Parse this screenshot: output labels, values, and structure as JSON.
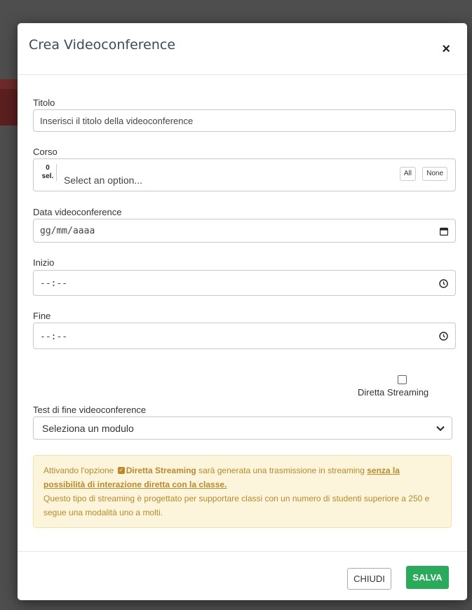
{
  "modal": {
    "title": "Crea Videoconference",
    "close_glyph": "×"
  },
  "form": {
    "titolo": {
      "label": "Titolo",
      "placeholder": "Inserisci il titolo della videoconference"
    },
    "corso": {
      "label": "Corso",
      "count": "0",
      "count_suffix": "sel.",
      "placeholder": "Select an option...",
      "all_label": "All",
      "none_label": "None"
    },
    "data": {
      "label": "Data videoconference",
      "value": "gg/mm/aaaa",
      "icon": "calendar-icon"
    },
    "inizio": {
      "label": "Inizio",
      "value": "--:--",
      "icon": "clock-icon"
    },
    "fine": {
      "label": "Fine",
      "value": "--:--",
      "icon": "clock-icon"
    },
    "diretta": {
      "label": "Diretta Streaming",
      "checked": false
    },
    "test": {
      "label": "Test di fine videoconference",
      "selected": "Seleziona un modulo"
    }
  },
  "alert": {
    "part1": "Attivando l'opzione",
    "bold_option": "Diretta Streaming",
    "part2": "sarà generata una trasmissione in streaming",
    "underline": "senza la possibilità di interazione diretta con la classe.",
    "part3": "Questo tipo di streaming è progettato per supportare classi con un numero di studenti superiore a 250 e segue una modalità uno a molti."
  },
  "footer": {
    "close_label": "CHIUDI",
    "save_label": "SALVA"
  },
  "colors": {
    "save": "#2aaa5a",
    "alert_bg": "#fcf5dc",
    "alert_text": "#b78a2c"
  }
}
